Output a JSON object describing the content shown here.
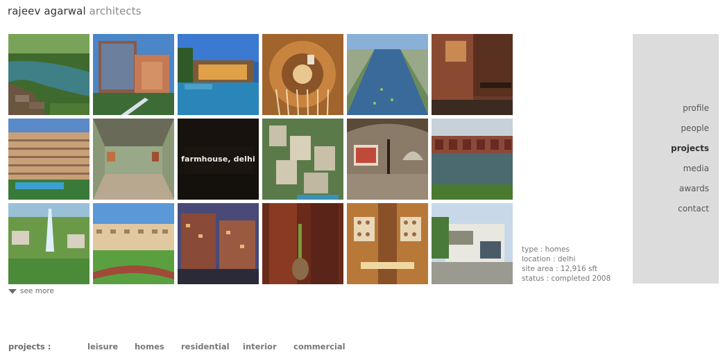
{
  "logo": {
    "name": "rajeev agarwal",
    "suffix": "architects"
  },
  "gallery": {
    "tiles": [
      {
        "icon": "resort-lagoon-image"
      },
      {
        "icon": "glass-office-tower-image"
      },
      {
        "icon": "pool-villa-dusk-image"
      },
      {
        "icon": "spiral-staircase-image"
      },
      {
        "icon": "canal-terraces-image"
      },
      {
        "icon": "brick-dining-interior-image"
      },
      {
        "icon": "apartment-block-pool-image"
      },
      {
        "icon": "gallery-hall-image"
      },
      {
        "icon": "farmhouse-night-image",
        "overlay_label": "farmhouse, delhi"
      },
      {
        "icon": "township-aerial-image"
      },
      {
        "icon": "vaulted-exhibition-image"
      },
      {
        "icon": "lakeside-cottages-image"
      },
      {
        "icon": "tower-masterplan-image"
      },
      {
        "icon": "housing-track-image"
      },
      {
        "icon": "brick-apartments-dusk-image"
      },
      {
        "icon": "wooden-doors-plant-image"
      },
      {
        "icon": "dining-room-plates-image"
      },
      {
        "icon": "modern-house-image"
      }
    ]
  },
  "see_more": {
    "label": "see more"
  },
  "info": {
    "type": "type : homes",
    "location": "location : delhi",
    "site_area": "site area : 12,916 sft",
    "status": "status : completed 2008"
  },
  "nav": {
    "items": [
      {
        "label": "profile"
      },
      {
        "label": "people"
      },
      {
        "label": "projects"
      },
      {
        "label": "media"
      },
      {
        "label": "awards"
      },
      {
        "label": "contact"
      }
    ],
    "active": "projects"
  },
  "footer": {
    "label": "projects :",
    "links": [
      "leisure",
      "homes",
      "residential",
      "interior",
      "commercial"
    ]
  },
  "colors": {
    "sidebar": "#dcdcdc",
    "text": "#6b6b6b",
    "logo_dark": "#333333"
  }
}
